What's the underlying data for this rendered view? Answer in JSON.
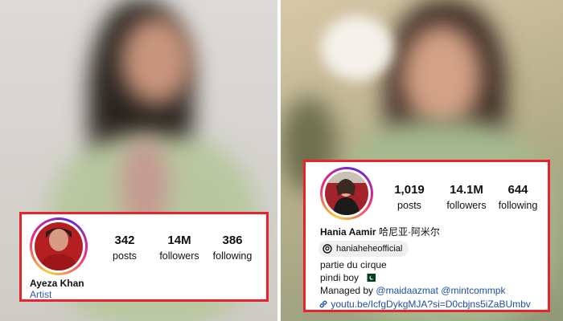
{
  "left_profile": {
    "stats": [
      {
        "value": "342",
        "label": "posts"
      },
      {
        "value": "14M",
        "label": "followers"
      },
      {
        "value": "386",
        "label": "following"
      }
    ],
    "name": "Ayeza Khan",
    "category": "Artist"
  },
  "right_profile": {
    "stats": [
      {
        "value": "1,019",
        "label": "posts"
      },
      {
        "value": "14.1M",
        "label": "followers"
      },
      {
        "value": "644",
        "label": "following"
      }
    ],
    "name": "Hania Aamir",
    "name_extra": "哈尼亚·阿米尔",
    "threads_handle": "haniaheheofficial",
    "bio_line1": "partie du cirque",
    "bio_line2": "pindi boy",
    "managed_prefix": "Managed by",
    "managed_handle1": "@maidaazmat",
    "managed_handle2": "@mintcommpk",
    "link": "youtu.be/IcfgDykgMJA?si=D0cbjns5iZaBUmbv"
  },
  "colors": {
    "highlight_border": "#e8232b",
    "link_blue": "#1f4fa3",
    "category_blue": "#2a5bb0"
  },
  "icons": [
    "threads-icon",
    "link-icon",
    "pakistan-flag-icon"
  ]
}
